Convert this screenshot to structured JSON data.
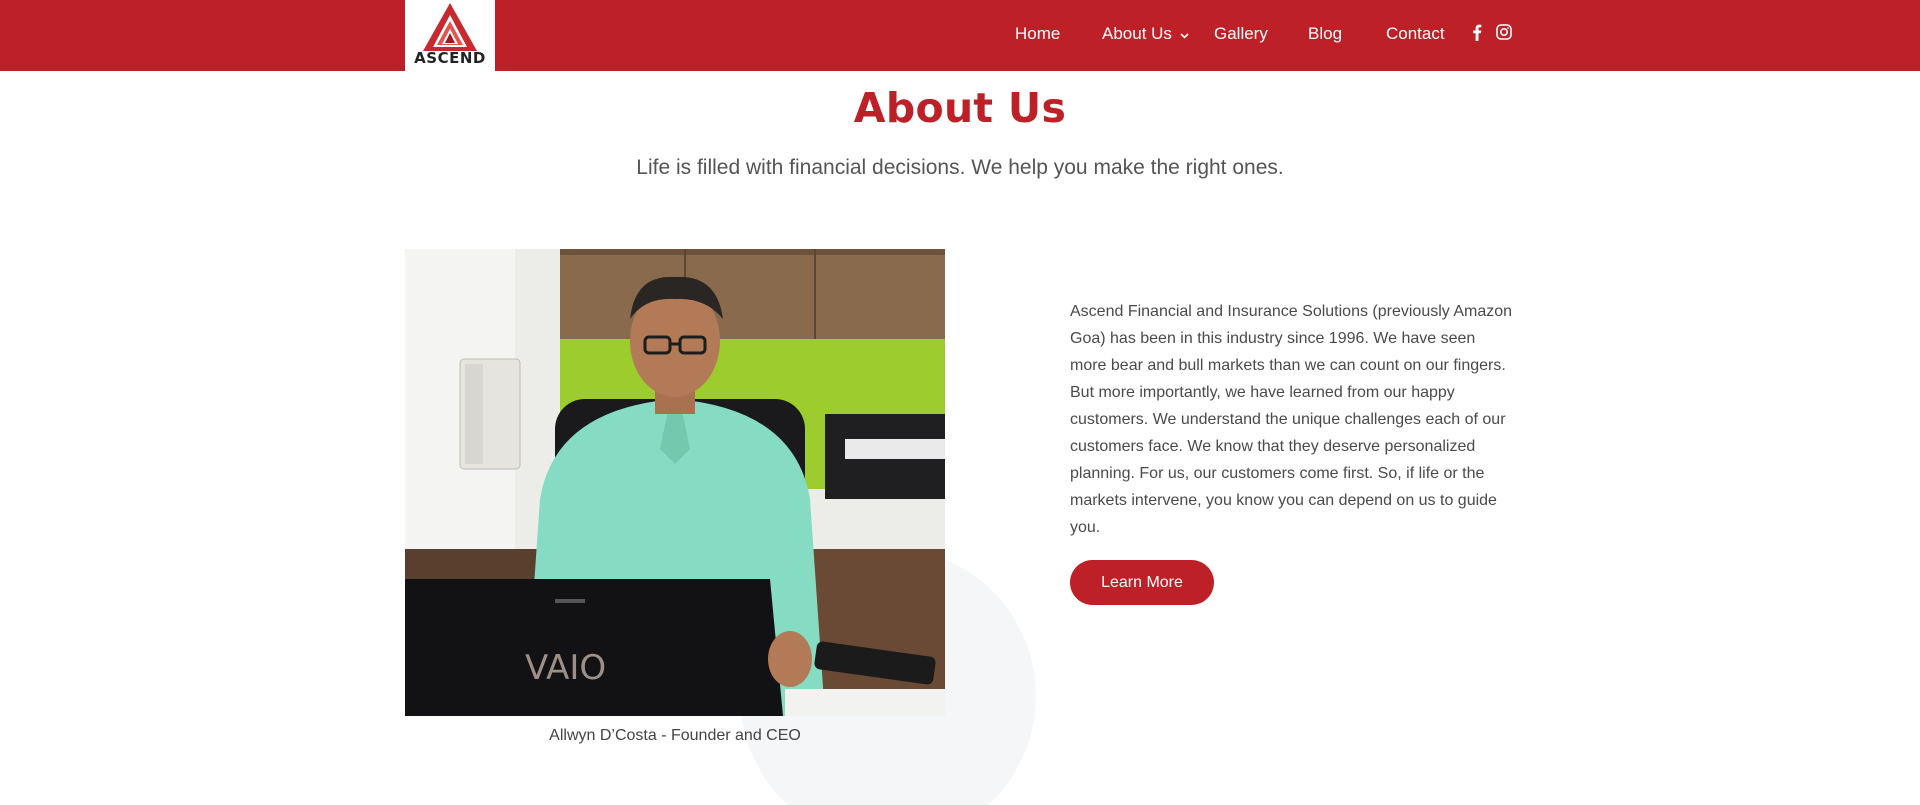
{
  "logo": {
    "text": "ASCEND"
  },
  "nav": {
    "items": [
      {
        "label": "Home"
      },
      {
        "label": "About Us"
      },
      {
        "label": "Gallery"
      },
      {
        "label": "Blog"
      },
      {
        "label": "Contact"
      }
    ],
    "social": [
      "facebook-icon",
      "instagram-icon"
    ]
  },
  "hero": {
    "title": "About Us",
    "subtitle": "Life is filled with financial decisions. We help you make the right ones."
  },
  "founder": {
    "caption": "Allwyn D’Costa - Founder and CEO"
  },
  "about": {
    "paragraph": "Ascend Financial and Insurance Solutions (previously Amazon Goa) has been in this industry since 1996. We have seen more bear and bull markets than we can count on our fingers. But more importantly, we have learned from our happy customers. We understand the unique challenges each of our customers face. We know that they deserve personalized planning. For us, our customers come first. So, if life or the markets intervene, you know you can depend on us to guide you.",
    "button_label": "Learn More"
  },
  "colors": {
    "brand": "#be2027",
    "text": "#444444",
    "decor": "#f5f6f8"
  }
}
